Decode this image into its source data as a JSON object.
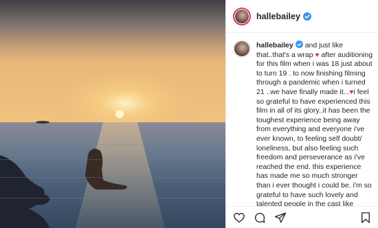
{
  "post": {
    "username": "hallebailey",
    "caption": {
      "username": "hallebailey",
      "part1": "and just like that..that's a wrap",
      "part2": "after auditioning for this film when i was 18 just about to turn 19 . to now finishing filming through a pandemic when i turned 21 ..we have finally made it...",
      "part3": "i feel so grateful to have experienced this film in all of its glory..it has been the toughest experience being away from everything and everyone i've ever known, to feeling self doubt/ loneliness, but also feeling such freedom and perseverance as i've reached the end. this experience has made me so much stronger than i ever thought i could be. i'm so grateful to have such lovely and talented people in the cast like @jonahhauerking that will be my friend for infinite lifetimes. @jacobtremblay who i'm so proud of"
    }
  },
  "colors": {
    "accent_verified": "#3897f0",
    "heart": "#e0245e",
    "text": "#262626"
  },
  "icons": {
    "like": "heart-outline-icon",
    "comment": "speech-bubble-icon",
    "share": "paper-plane-icon",
    "save": "bookmark-icon"
  }
}
